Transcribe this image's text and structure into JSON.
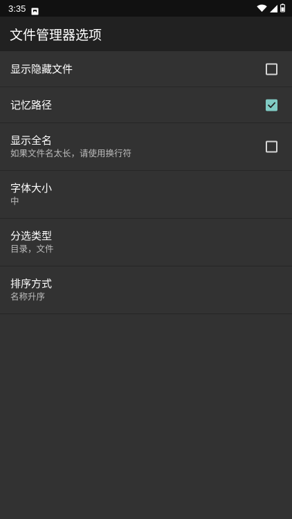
{
  "status_bar": {
    "time": "3:35",
    "icons": [
      "notification-icon",
      "wifi-icon",
      "signal-icon",
      "battery-icon"
    ]
  },
  "app_bar": {
    "title": "文件管理器选项"
  },
  "settings": [
    {
      "title": "显示隐藏文件",
      "subtitle": "",
      "control": "checkbox",
      "checked": false
    },
    {
      "title": "记忆路径",
      "subtitle": "",
      "control": "checkbox",
      "checked": true
    },
    {
      "title": "显示全名",
      "subtitle": "如果文件名太长，请使用换行符",
      "control": "checkbox",
      "checked": false
    },
    {
      "title": "字体大小",
      "subtitle": "中",
      "control": "none"
    },
    {
      "title": "分选类型",
      "subtitle": "目录，文件",
      "control": "none"
    },
    {
      "title": "排序方式",
      "subtitle": "名称升序",
      "control": "none"
    }
  ],
  "colors": {
    "background": "#323232",
    "app_bar": "#212121",
    "status_bar": "#111111",
    "accent": "#80cbc4",
    "divider": "#262626"
  }
}
